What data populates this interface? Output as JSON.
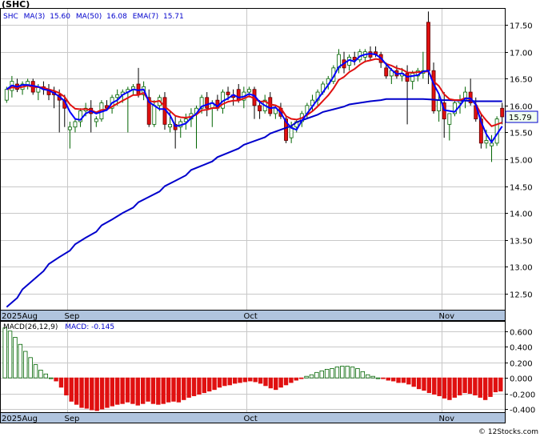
{
  "title": "(SHC)",
  "chart_data": [
    {
      "type": "candlestick",
      "ylim": [
        12.2,
        17.8
      ],
      "yticks": [
        12.5,
        13.0,
        13.5,
        14.0,
        14.5,
        15.0,
        15.5,
        16.0,
        16.5,
        17.0,
        17.5
      ],
      "ytick_labels": [
        "12.50",
        "13.00",
        "13.50",
        "14.00",
        "14.50",
        "15.00",
        "15.50",
        "16.00",
        "16.50",
        "17.00",
        "17.50"
      ],
      "x_labels": [
        "2025Aug",
        "Sep",
        "Oct",
        "Nov"
      ],
      "x_label_index": [
        0,
        12,
        46,
        83
      ],
      "grid": true,
      "legend": {
        "ticker": "SHC",
        "ma3_label": "MA(3)",
        "ma3_value": "15.60",
        "ma50_label": "MA(50)",
        "ma50_value": "16.08",
        "ema7_label": "EMA(7)",
        "ema7_value": "15.71"
      },
      "last_price": "15.79",
      "ohlc": [
        [
          16.1,
          16.35,
          16.05,
          16.3
        ],
        [
          16.28,
          16.55,
          16.15,
          16.45
        ],
        [
          16.4,
          16.5,
          16.25,
          16.3
        ],
        [
          16.3,
          16.45,
          16.2,
          16.4
        ],
        [
          16.38,
          16.5,
          16.3,
          16.45
        ],
        [
          16.45,
          16.5,
          16.2,
          16.25
        ],
        [
          16.25,
          16.4,
          16.1,
          16.35
        ],
        [
          16.35,
          16.45,
          16.2,
          16.3
        ],
        [
          16.3,
          16.4,
          16.1,
          16.2
        ],
        [
          16.25,
          16.35,
          15.95,
          16.2
        ],
        [
          16.2,
          16.3,
          15.5,
          16.1
        ],
        [
          16.1,
          16.2,
          15.6,
          15.95
        ],
        [
          15.55,
          15.7,
          15.2,
          15.6
        ],
        [
          15.6,
          15.75,
          15.5,
          15.7
        ],
        [
          15.7,
          15.95,
          15.6,
          15.9
        ],
        [
          15.9,
          16.05,
          15.8,
          15.95
        ],
        [
          15.95,
          16.1,
          15.5,
          15.85
        ],
        [
          15.7,
          15.8,
          15.6,
          15.75
        ],
        [
          15.75,
          16.1,
          15.7,
          16.05
        ],
        [
          16.0,
          16.1,
          15.9,
          15.95
        ],
        [
          15.95,
          16.2,
          15.85,
          16.15
        ],
        [
          16.15,
          16.3,
          16.0,
          16.2
        ],
        [
          16.2,
          16.3,
          16.05,
          16.25
        ],
        [
          16.25,
          16.35,
          15.5,
          16.3
        ],
        [
          16.3,
          16.4,
          16.2,
          16.35
        ],
        [
          16.4,
          16.7,
          16.15,
          16.2
        ],
        [
          16.2,
          16.45,
          16.1,
          16.35
        ],
        [
          16.15,
          16.3,
          15.6,
          15.65
        ],
        [
          15.65,
          16.1,
          15.6,
          16.0
        ],
        [
          16.0,
          16.2,
          15.9,
          16.15
        ],
        [
          16.15,
          16.25,
          15.55,
          15.65
        ],
        [
          15.6,
          15.9,
          15.5,
          15.65
        ],
        [
          15.65,
          15.8,
          15.2,
          15.55
        ],
        [
          15.6,
          15.75,
          15.4,
          15.7
        ],
        [
          15.7,
          15.85,
          15.55,
          15.75
        ],
        [
          15.75,
          15.95,
          15.6,
          15.85
        ],
        [
          15.85,
          16.0,
          15.2,
          15.95
        ],
        [
          15.95,
          16.2,
          15.85,
          16.15
        ],
        [
          16.15,
          16.25,
          15.8,
          15.95
        ],
        [
          15.95,
          16.1,
          15.6,
          16.05
        ],
        [
          16.1,
          16.2,
          15.9,
          15.95
        ],
        [
          15.95,
          16.3,
          15.85,
          16.25
        ],
        [
          16.25,
          16.35,
          16.1,
          16.2
        ],
        [
          16.2,
          16.3,
          16.0,
          16.15
        ],
        [
          16.3,
          16.4,
          16.05,
          16.1
        ],
        [
          16.1,
          16.35,
          15.95,
          16.25
        ],
        [
          16.25,
          16.35,
          16.15,
          16.3
        ],
        [
          16.3,
          16.35,
          15.75,
          16.0
        ],
        [
          16.0,
          16.1,
          15.75,
          15.9
        ],
        [
          15.9,
          16.2,
          15.85,
          16.1
        ],
        [
          16.15,
          16.25,
          15.8,
          15.85
        ],
        [
          15.85,
          16.0,
          15.75,
          15.95
        ],
        [
          15.95,
          16.05,
          15.75,
          15.8
        ],
        [
          15.75,
          15.8,
          15.3,
          15.35
        ],
        [
          15.4,
          15.7,
          15.3,
          15.6
        ],
        [
          15.6,
          15.75,
          15.5,
          15.7
        ],
        [
          15.7,
          15.9,
          15.6,
          15.85
        ],
        [
          15.85,
          16.05,
          15.75,
          16.0
        ],
        [
          16.0,
          16.2,
          15.9,
          16.1
        ],
        [
          16.1,
          16.3,
          16.0,
          16.25
        ],
        [
          16.25,
          16.45,
          16.2,
          16.4
        ],
        [
          16.4,
          16.55,
          16.3,
          16.5
        ],
        [
          16.45,
          16.75,
          16.4,
          16.7
        ],
        [
          16.7,
          17.05,
          16.6,
          16.95
        ],
        [
          16.85,
          17.0,
          16.6,
          16.7
        ],
        [
          16.75,
          16.95,
          16.65,
          16.9
        ],
        [
          16.9,
          17.0,
          16.75,
          16.85
        ],
        [
          16.85,
          17.05,
          16.8,
          17.0
        ],
        [
          16.9,
          17.05,
          16.8,
          17.0
        ],
        [
          17.0,
          17.1,
          16.85,
          16.9
        ],
        [
          17.0,
          17.1,
          16.9,
          16.95
        ],
        [
          16.95,
          17.0,
          16.7,
          16.8
        ],
        [
          16.7,
          16.8,
          16.5,
          16.55
        ],
        [
          16.55,
          16.7,
          16.4,
          16.65
        ],
        [
          16.65,
          16.75,
          16.5,
          16.55
        ],
        [
          16.55,
          16.7,
          16.45,
          16.6
        ],
        [
          16.6,
          16.75,
          15.65,
          16.45
        ],
        [
          16.45,
          16.65,
          16.3,
          16.6
        ],
        [
          16.55,
          16.7,
          16.45,
          16.65
        ],
        [
          16.6,
          17.0,
          16.5,
          16.65
        ],
        [
          17.55,
          17.75,
          16.4,
          16.65
        ],
        [
          16.65,
          16.8,
          15.85,
          15.9
        ],
        [
          15.9,
          16.2,
          15.7,
          16.1
        ],
        [
          16.05,
          16.25,
          15.4,
          15.75
        ],
        [
          15.65,
          15.85,
          15.35,
          15.85
        ],
        [
          15.85,
          16.1,
          15.8,
          16.05
        ],
        [
          16.05,
          16.2,
          15.85,
          16.1
        ],
        [
          16.1,
          16.35,
          15.95,
          16.25
        ],
        [
          16.25,
          16.5,
          16.0,
          16.05
        ],
        [
          16.0,
          16.15,
          15.7,
          15.75
        ],
        [
          15.75,
          15.85,
          15.2,
          15.3
        ],
        [
          15.3,
          15.55,
          15.2,
          15.35
        ],
        [
          15.25,
          15.45,
          14.95,
          15.3
        ],
        [
          15.3,
          15.8,
          15.25,
          15.75
        ],
        [
          15.95,
          16.05,
          15.65,
          15.79
        ]
      ],
      "ma50": [
        12.25,
        12.42,
        12.58,
        12.75,
        12.92,
        13.05,
        13.18,
        13.3,
        13.42,
        13.54,
        13.65,
        13.77,
        13.88,
        14.0,
        14.1,
        14.2,
        14.3,
        14.4,
        14.5,
        14.6,
        14.7,
        14.8,
        14.88,
        14.96,
        15.04,
        15.12,
        15.2,
        15.27,
        15.34,
        15.41,
        15.48,
        15.55,
        15.62,
        15.69,
        15.76,
        15.83,
        15.88,
        15.93,
        15.98,
        16.02,
        16.05,
        16.08,
        16.1,
        16.12,
        16.12,
        16.12,
        16.12,
        16.12,
        16.11,
        16.1,
        16.1,
        16.09,
        16.09,
        16.08,
        16.08,
        16.08,
        16.08
      ],
      "ma50_start": 1,
      "ma3_range": [
        5.2,
        5.0
      ],
      "ema7_range": [
        5.9,
        5.7
      ]
    },
    {
      "type": "bar",
      "title": "MACD(26,12,9)",
      "legend": {
        "label": "MACD(26,12,9)",
        "macd_label": "MACD:",
        "macd_value": "-0.145"
      },
      "ylim": [
        -0.44,
        0.72
      ],
      "yticks": [
        0.6,
        0.4,
        0.2,
        0.0,
        -0.2,
        -0.4
      ],
      "ytick_labels": [
        "0.600",
        "0.400",
        "0.200",
        "0.000",
        "-0.200",
        "-0.400"
      ],
      "x_labels": [
        "2025Aug",
        "Sep",
        "Oct",
        "Nov"
      ],
      "x_label_index": [
        0,
        12,
        46,
        83
      ],
      "values": [
        0.64,
        0.6,
        0.52,
        0.43,
        0.34,
        0.26,
        0.17,
        0.1,
        0.05,
        0.0,
        -0.04,
        -0.12,
        -0.22,
        -0.3,
        -0.34,
        -0.38,
        -0.39,
        -0.41,
        -0.42,
        -0.4,
        -0.38,
        -0.36,
        -0.34,
        -0.33,
        -0.31,
        -0.33,
        -0.35,
        -0.33,
        -0.3,
        -0.33,
        -0.34,
        -0.33,
        -0.31,
        -0.3,
        -0.31,
        -0.28,
        -0.25,
        -0.23,
        -0.21,
        -0.19,
        -0.17,
        -0.15,
        -0.12,
        -0.1,
        -0.09,
        -0.07,
        -0.06,
        -0.05,
        -0.04,
        -0.05,
        -0.07,
        -0.1,
        -0.13,
        -0.15,
        -0.12,
        -0.09,
        -0.06,
        -0.03,
        -0.01,
        0.02,
        0.04,
        0.07,
        0.09,
        0.11,
        0.12,
        0.14,
        0.15,
        0.15,
        0.14,
        0.12,
        0.08,
        0.04,
        0.02,
        0.0,
        -0.01,
        -0.03,
        -0.04,
        -0.06,
        -0.06,
        -0.08,
        -0.11,
        -0.14,
        -0.16,
        -0.19,
        -0.21,
        -0.23,
        -0.26,
        -0.28,
        -0.25,
        -0.22,
        -0.19,
        -0.2,
        -0.22,
        -0.25,
        -0.28,
        -0.24,
        -0.18,
        -0.17
      ]
    }
  ],
  "colors": {
    "up": "#006400",
    "down": "#e01010",
    "ma50": "#0000cc",
    "ema7": "#e01010",
    "ma3": "#0000ff",
    "axis_band": "#b0c4de",
    "grid": "#c8c8c8",
    "price_box_bg": "#f0fff0",
    "price_box_border": "#0000cc"
  },
  "footer": "© 12Stocks.com"
}
